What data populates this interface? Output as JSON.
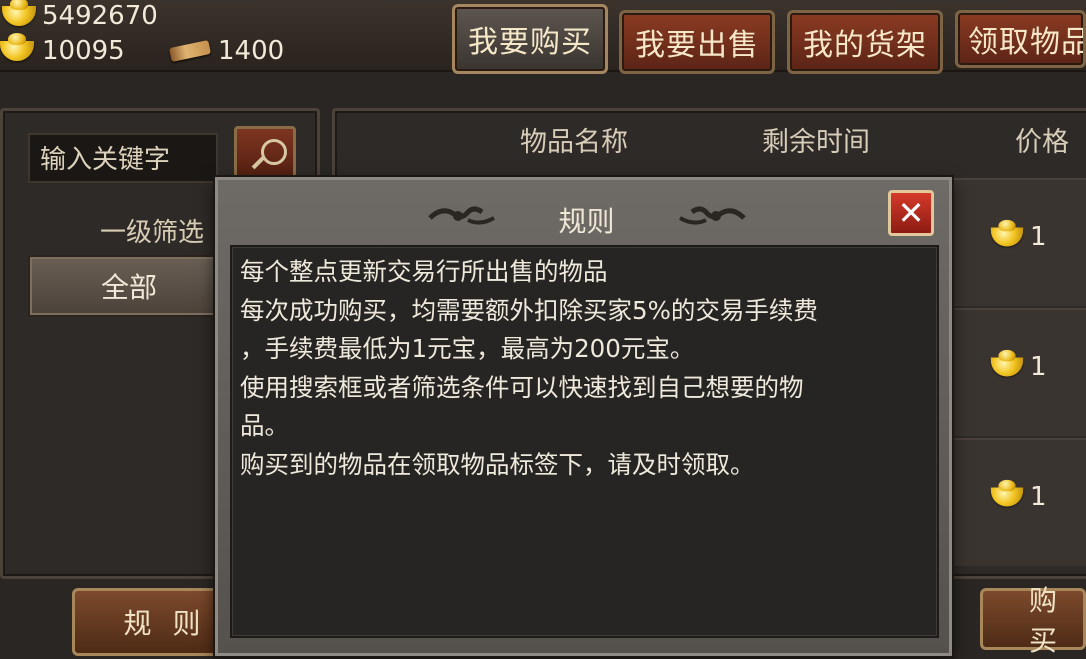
{
  "currency": {
    "silver": "5492670",
    "gold": "10095",
    "scrolls": "1400"
  },
  "tabs": [
    {
      "label": "我要购买",
      "active": true
    },
    {
      "label": "我要出售",
      "active": false
    },
    {
      "label": "我的货架",
      "active": false
    },
    {
      "label": "领取物品",
      "active": false
    }
  ],
  "search": {
    "placeholder": "输入关键字"
  },
  "filter": {
    "label": "一级筛选",
    "value": "全部"
  },
  "table": {
    "headers": [
      "物品名称",
      "剩余时间",
      "价格"
    ],
    "prices": [
      "1",
      "1",
      "1"
    ]
  },
  "bottom": {
    "rules_label": "规 则",
    "buy_label": "购 买"
  },
  "modal": {
    "title": "规则",
    "lines": [
      "每个整点更新交易行所出售的物品",
      "每次成功购买，均需要额外扣除买家5%的交易手续费",
      "，手续费最低为1元宝，最高为200元宝。",
      "使用搜索框或者筛选条件可以快速找到自己想要的物",
      "品。",
      "购买到的物品在领取物品标签下，请及时领取。"
    ]
  },
  "colors": {
    "tab_active": "#4a433d",
    "tab_idle": "#7a3320",
    "close": "#c0301f"
  }
}
